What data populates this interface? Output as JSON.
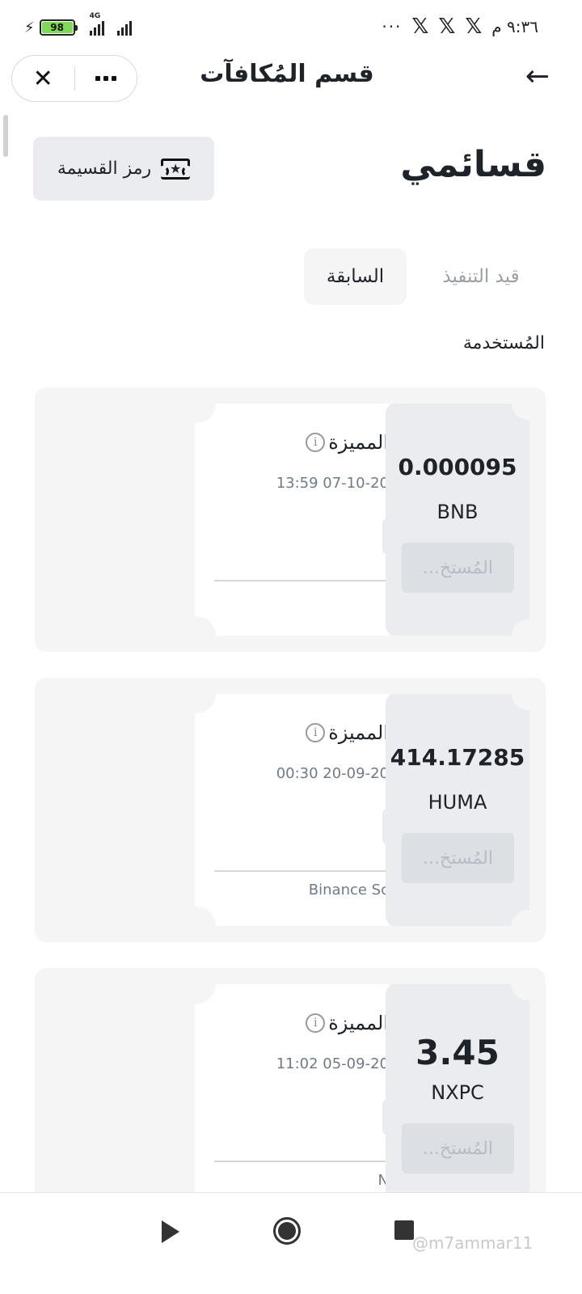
{
  "status_bar": {
    "battery": "98",
    "network": "4G",
    "time": "٩:٣٦ م",
    "app_icons": [
      "x-icon",
      "x-icon",
      "x-icon"
    ],
    "overflow": "···"
  },
  "header": {
    "title": "قسم المُكافآت",
    "close_icon": "close-icon",
    "more_icon": "more-icon",
    "back_icon": "arrow-right-icon"
  },
  "page": {
    "section_title": "قسائمي",
    "voucher_button_label": "رمز القسيمة"
  },
  "tabs": [
    {
      "label": "قيد التنفيذ",
      "active": false
    },
    {
      "label": "السابقة",
      "active": true
    }
  ],
  "list_label": "المُستخدمة",
  "vouchers": [
    {
      "title": "المميزة",
      "date": "13:59 07-10-20",
      "footer": "",
      "amount": "0.000095",
      "currency": "BNB",
      "status_button": "المُستخ..."
    },
    {
      "title": "المميزة",
      "date": "00:30 20-09-20",
      "footer": "Binance Sc",
      "amount": "414.17285",
      "currency": "HUMA",
      "status_button": "المُستخ..."
    },
    {
      "title": "المميزة",
      "date": "11:02 05-09-20",
      "footer": "N",
      "amount": "3.45",
      "currency": "NXPC",
      "status_button": "المُستخ..."
    }
  ],
  "watermark": "@m7ammar11",
  "colors": {
    "accent_bg": "#eaecef",
    "card_bg": "#f5f5f5",
    "muted_text": "#707a8a",
    "battery_fill": "#7ed957"
  }
}
